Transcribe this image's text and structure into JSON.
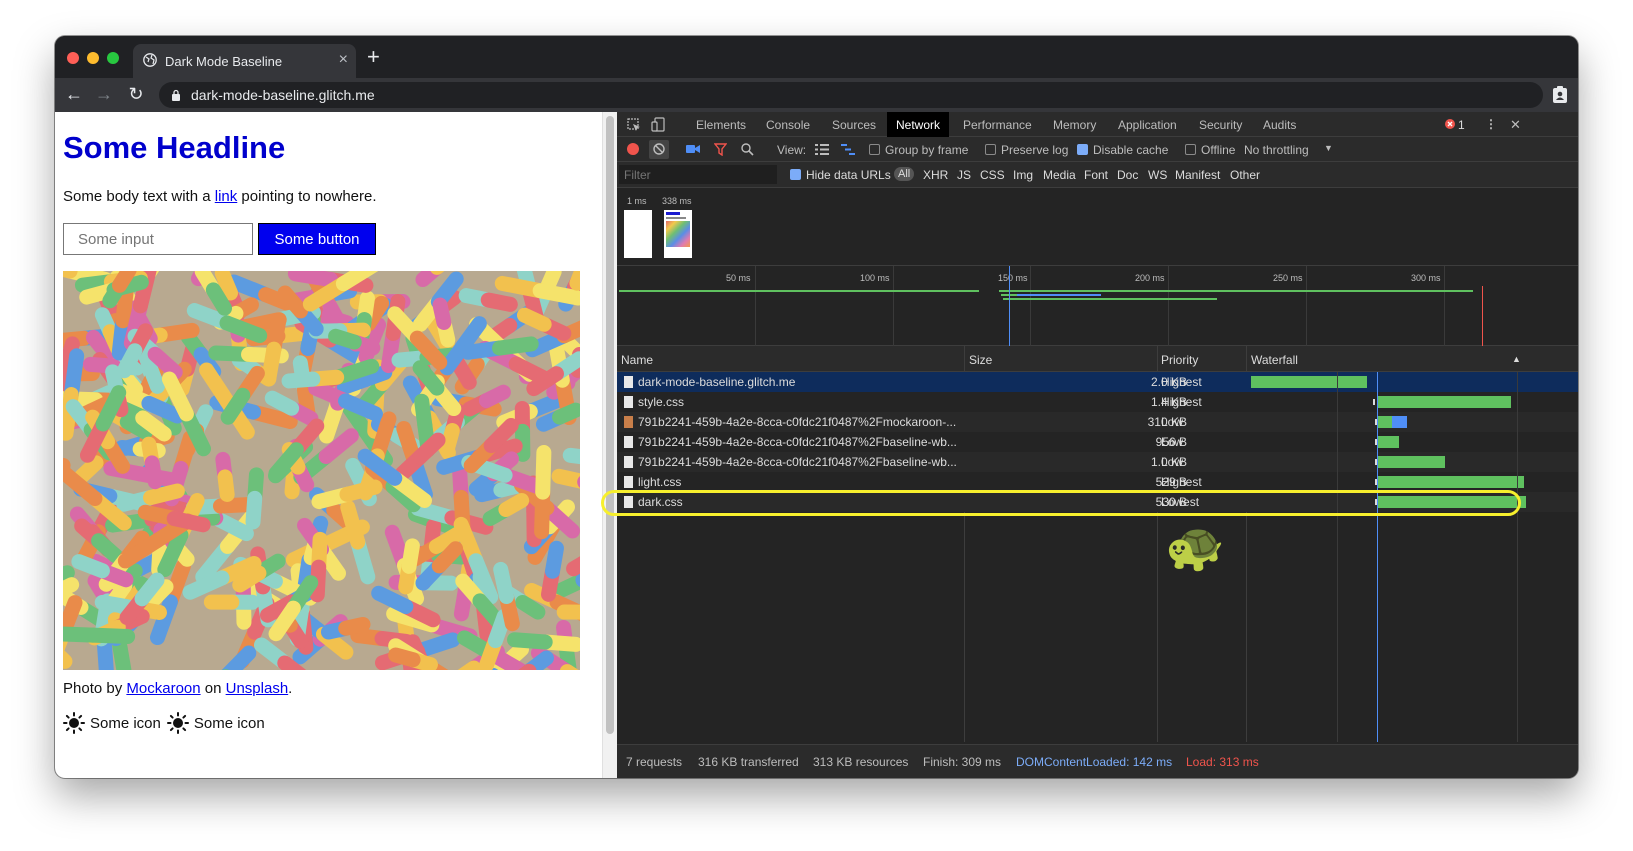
{
  "browser": {
    "tab_title": "Dark Mode Baseline",
    "tab_close": "×",
    "new_tab": "+",
    "url": "dark-mode-baseline.glitch.me",
    "back": "←",
    "forward": "→",
    "reload": "↻",
    "menu": "⋮"
  },
  "page": {
    "headline": "Some Headline",
    "body_prefix": "Some body text with a ",
    "body_link": "link",
    "body_suffix": " pointing to nowhere.",
    "input_placeholder": "Some input",
    "button_label": "Some button",
    "credit_prefix": "Photo by ",
    "credit_author": "Mockaroon",
    "credit_mid": " on ",
    "credit_site": "Unsplash",
    "credit_suffix": ".",
    "icon_label_1": "Some icon",
    "icon_label_2": "Some icon"
  },
  "devtools": {
    "tabs": [
      "Elements",
      "Console",
      "Sources",
      "Network",
      "Performance",
      "Memory",
      "Application",
      "Security",
      "Audits"
    ],
    "active_tab": "Network",
    "error_count": "1",
    "close": "✕",
    "menu": "⋮",
    "toolbar": {
      "view_label": "View:",
      "group_by_frame": "Group by frame",
      "preserve_log": "Preserve log",
      "disable_cache": "Disable cache",
      "offline": "Offline",
      "throttling": "No throttling"
    },
    "filter": {
      "placeholder": "Filter",
      "hide_data_urls": "Hide data URLs",
      "types": [
        "All",
        "XHR",
        "JS",
        "CSS",
        "Img",
        "Media",
        "Font",
        "Doc",
        "WS",
        "Manifest",
        "Other"
      ]
    },
    "screenshots": {
      "label_1": "1 ms",
      "label_2": "338 ms"
    },
    "overview_ticks": [
      "50 ms",
      "100 ms",
      "150 ms",
      "200 ms",
      "250 ms",
      "300 ms"
    ],
    "columns": {
      "name": "Name",
      "size": "Size",
      "priority": "Priority",
      "waterfall": "Waterfall",
      "sort_icon": "▲"
    },
    "requests": [
      {
        "name": "dark-mode-baseline.glitch.me",
        "size": "2.0 KB",
        "priority": "Highest"
      },
      {
        "name": "style.css",
        "size": "1.4 KB",
        "priority": "Highest"
      },
      {
        "name": "791b2241-459b-4a2e-8cca-c0fdc21f0487%2Fmockaroon-...",
        "size": "310 KB",
        "priority": "Low"
      },
      {
        "name": "791b2241-459b-4a2e-8cca-c0fdc21f0487%2Fbaseline-wb...",
        "size": "956 B",
        "priority": "Low"
      },
      {
        "name": "791b2241-459b-4a2e-8cca-c0fdc21f0487%2Fbaseline-wb...",
        "size": "1.0 KB",
        "priority": "Low"
      },
      {
        "name": "light.css",
        "size": "529 B",
        "priority": "Highest"
      },
      {
        "name": "dark.css",
        "size": "530 B",
        "priority": "Lowest"
      }
    ],
    "status": {
      "requests": "7 requests",
      "transferred": "316 KB transferred",
      "resources": "313 KB resources",
      "finish": "Finish: 309 ms",
      "dcl": "DOMContentLoaded: 142 ms",
      "load": "Load: 313 ms"
    },
    "empty_state_emoji": "🐢"
  },
  "colors": {
    "headline": "#0000cc",
    "button_bg": "#0000ee",
    "highlight": "#f7ef2d",
    "dcl": "#7cacf8",
    "load": "#f0544c",
    "waterfall_green": "#5fc15f"
  }
}
